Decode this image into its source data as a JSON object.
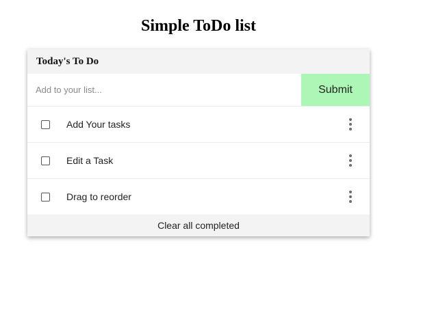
{
  "page": {
    "title": "Simple ToDo list"
  },
  "card": {
    "header": "Today's To Do",
    "input": {
      "placeholder": "Add to your list...",
      "value": ""
    },
    "submit_label": "Submit",
    "tasks": [
      {
        "label": "Add Your tasks",
        "checked": false,
        "menu_icon": "more-vertical-icon"
      },
      {
        "label": "Edit a Task",
        "checked": false,
        "menu_icon": "more-vertical-icon"
      },
      {
        "label": "Drag to reorder",
        "checked": false,
        "menu_icon": "more-vertical-icon"
      }
    ],
    "footer_label": "Clear all completed"
  },
  "colors": {
    "submit_bg": "#adf7b6",
    "header_bg": "#f3f3f3",
    "footer_bg": "#f3f3f3"
  }
}
